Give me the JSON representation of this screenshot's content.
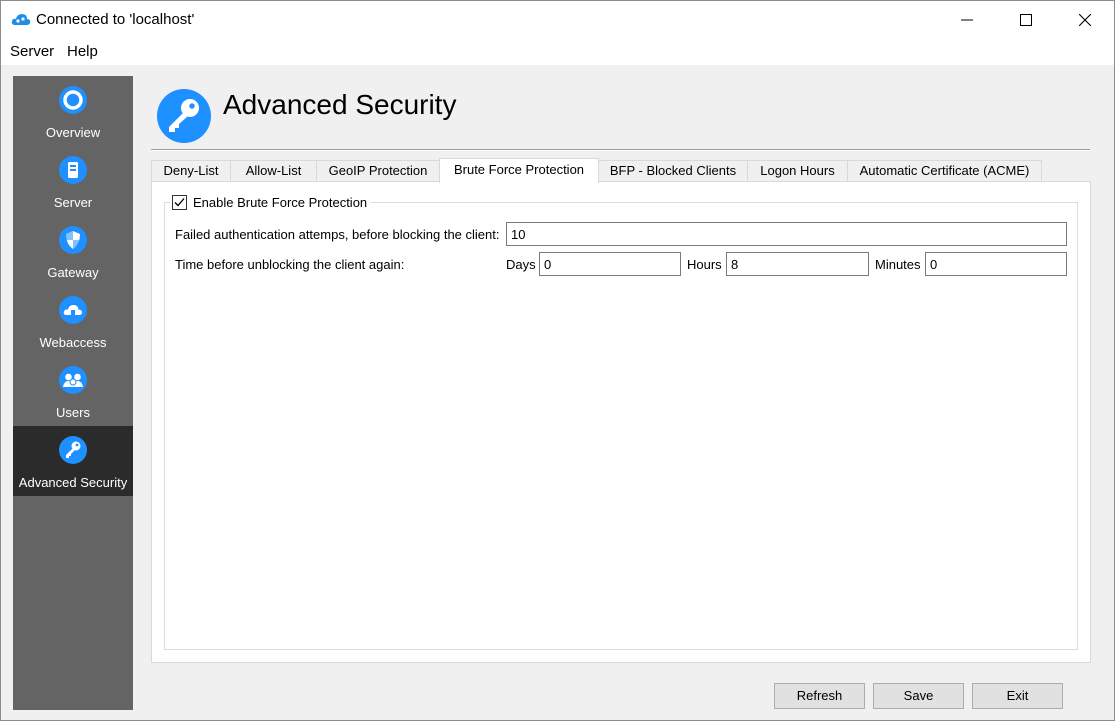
{
  "window": {
    "title": "Connected to 'localhost'"
  },
  "menu": {
    "items": [
      "Server",
      "Help"
    ]
  },
  "sidebar": {
    "items": [
      {
        "label": "Overview",
        "icon": "overview-icon"
      },
      {
        "label": "Server",
        "icon": "server-icon"
      },
      {
        "label": "Gateway",
        "icon": "shield-icon"
      },
      {
        "label": "Webaccess",
        "icon": "cloud-icon"
      },
      {
        "label": "Users",
        "icon": "users-icon"
      },
      {
        "label": "Advanced Security",
        "icon": "key-icon",
        "active": true
      }
    ]
  },
  "header": {
    "title": "Advanced Security",
    "icon": "key-icon"
  },
  "tabs": {
    "items": [
      "Deny-List",
      "Allow-List",
      "GeoIP Protection",
      "Brute Force Protection",
      "BFP - Blocked Clients",
      "Logon Hours",
      "Automatic Certificate (ACME)"
    ],
    "active_index": 3
  },
  "bfp": {
    "enable_label": "Enable Brute Force Protection",
    "enabled": true,
    "failed_label": "Failed authentication attemps, before blocking the client:",
    "failed_value": "10",
    "unblock_label": "Time before unblocking the client again:",
    "days_label": "Days",
    "days_value": "0",
    "hours_label": "Hours",
    "hours_value": "8",
    "minutes_label": "Minutes",
    "minutes_value": "0"
  },
  "footer": {
    "refresh_label": "Refresh",
    "save_label": "Save",
    "exit_label": "Exit"
  },
  "colors": {
    "accent": "#1e90ff",
    "sidebar_bg": "#646464",
    "sidebar_active": "#2b2b2b"
  }
}
